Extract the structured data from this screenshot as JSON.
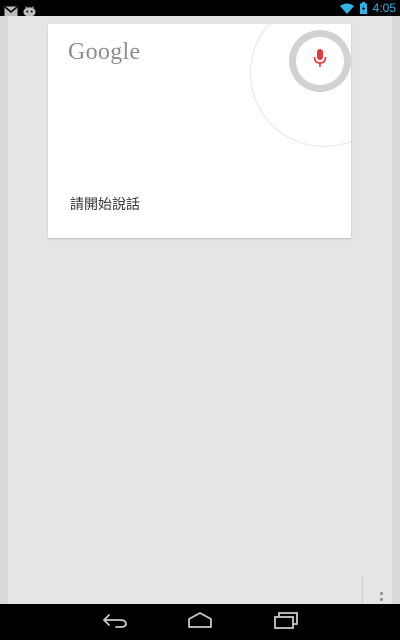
{
  "status_bar": {
    "time": "4:05",
    "notification_icons": [
      "gmail-icon",
      "android-debug-icon"
    ],
    "system_icons": [
      "wifi-icon",
      "battery-icon"
    ],
    "accent_color": "#33b5e5"
  },
  "search_card": {
    "logo_text": "Google",
    "prompt": "請開始說話",
    "mic_icon": "microphone-icon",
    "mic_color": "#e53935"
  },
  "overflow_menu": {
    "icon": "overflow-menu-icon"
  },
  "nav_bar": {
    "buttons": [
      "back-icon",
      "home-icon",
      "recents-icon"
    ]
  }
}
